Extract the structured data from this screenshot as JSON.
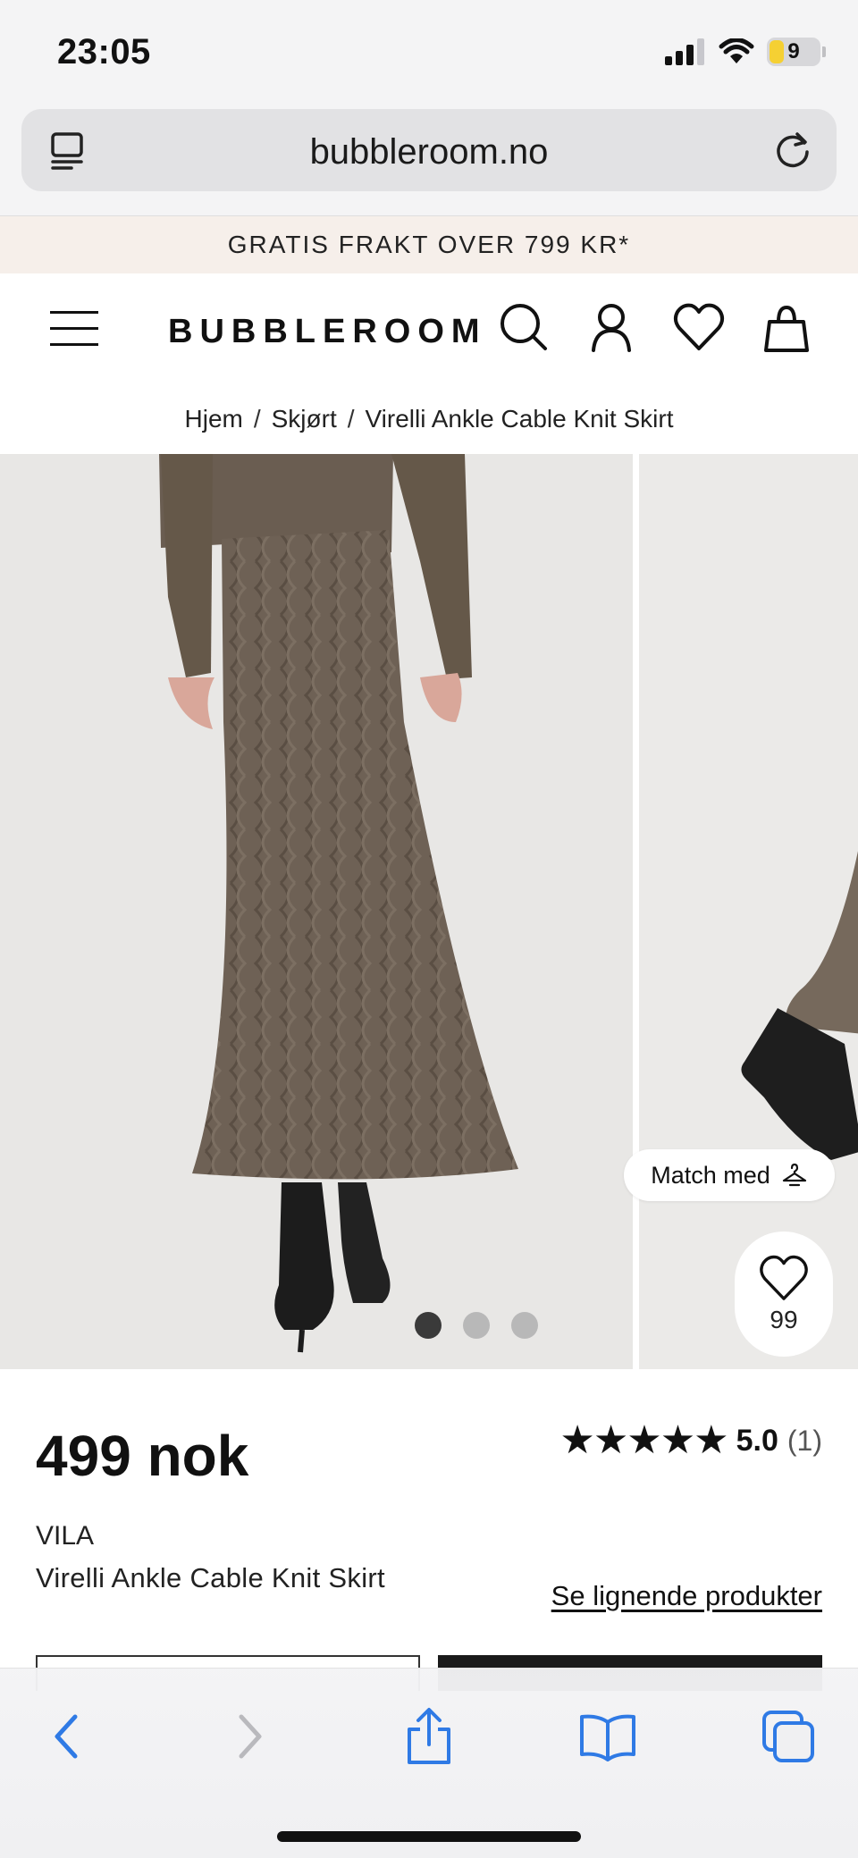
{
  "status_bar": {
    "time": "23:05",
    "battery": "9"
  },
  "browser": {
    "url": "bubbleroom.no"
  },
  "promo": {
    "text": "GRATIS FRAKT OVER 799 KR*"
  },
  "header": {
    "logo": "BUBBLEROOM"
  },
  "breadcrumb": {
    "items": [
      "Hjem",
      "Skjørt",
      "Virelli Ankle Cable Knit Skirt"
    ],
    "separator": "/"
  },
  "gallery": {
    "dot_count": 3,
    "active_dot": 0,
    "match_label": "Match med",
    "favorite_count": "99"
  },
  "product": {
    "price": "499 nok",
    "stars": "★★★★★",
    "rating_value": "5.0",
    "rating_count": "(1)",
    "brand": "VILA",
    "name": "Virelli Ankle Cable Knit Skirt",
    "similar_link": "Se lignende produkter"
  },
  "colors": {
    "accent_ios": "#2f7ae5",
    "promo_bg": "#f6efea",
    "text": "#1a1a1a",
    "skirt": "#6b5e52"
  }
}
